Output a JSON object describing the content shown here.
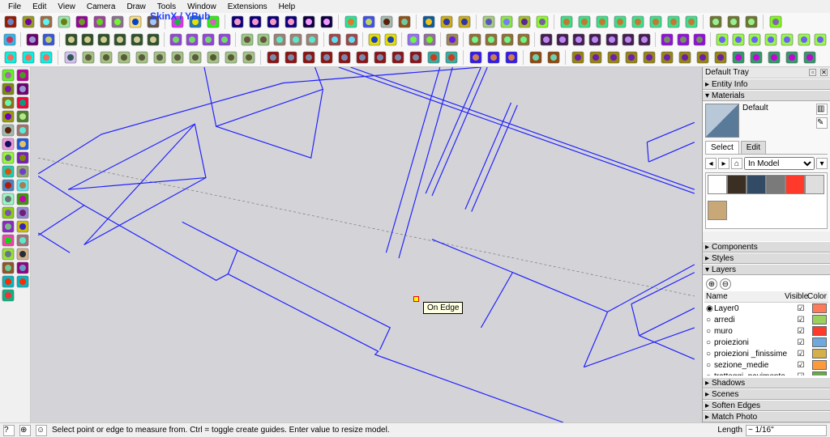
{
  "menubar": [
    "File",
    "Edit",
    "View",
    "Camera",
    "Draw",
    "Tools",
    "Window",
    "Extensions",
    "Help"
  ],
  "plugin_title": "SkinX / YBub",
  "tooltip": "On Edge",
  "tray": {
    "title": "Default Tray",
    "sections": {
      "entity_info": "Entity Info",
      "materials": "Materials",
      "components": "Components",
      "styles": "Styles",
      "layers": "Layers",
      "shadows": "Shadows",
      "scenes": "Scenes",
      "soften": "Soften Edges",
      "match_photo": "Match Photo"
    }
  },
  "materials": {
    "name": "Default",
    "tabs": {
      "select": "Select",
      "edit": "Edit"
    },
    "dropdown": "In Model",
    "swatches": [
      "#ffffff",
      "#3b2e23",
      "#334a65",
      "#7a7a7a",
      "#ff3a2a",
      "#dedede",
      "#c9a877"
    ]
  },
  "layers": {
    "controls": {
      "add": "⊕",
      "remove": "⊖"
    },
    "headers": {
      "name": "Name",
      "visible": "Visible",
      "color": "Color"
    },
    "items": [
      {
        "name": "Layer0",
        "visible": true,
        "current": true,
        "color": "#ff7a5a"
      },
      {
        "name": "arredi",
        "visible": true,
        "current": false,
        "color": "#9ad05b"
      },
      {
        "name": "muro",
        "visible": true,
        "current": false,
        "color": "#ff3a2a"
      },
      {
        "name": "proiezioni",
        "visible": true,
        "current": false,
        "color": "#6fa8dc"
      },
      {
        "name": "proiezioni _finissime",
        "visible": true,
        "current": false,
        "color": "#d4b04a"
      },
      {
        "name": "sezione_medie",
        "visible": true,
        "current": false,
        "color": "#ff9a3a"
      },
      {
        "name": "tratteggi_pavimento",
        "visible": true,
        "current": false,
        "color": "#6aa84f"
      }
    ]
  },
  "status": {
    "hint": "Select point or edge to measure from. Ctrl = toggle create guides. Enter value to resize model.",
    "length_label": "Length",
    "length_value": "~ 1/16\""
  },
  "icons": {
    "row1": [
      "undo",
      "redo",
      "new",
      "open",
      "save",
      "cut",
      "copy",
      "paste",
      "erase",
      "sep",
      "red-sq",
      "orange-sq",
      "question",
      "sep",
      "cube1",
      "cube2",
      "cube3",
      "cube4",
      "cube5",
      "cube6",
      "sep",
      "slash",
      "pencil",
      "arc",
      "wave",
      "sep",
      "cross",
      "cross2",
      "cross3",
      "sep",
      "up",
      "down",
      "box",
      "box2",
      "sep",
      "book1",
      "book2",
      "book3",
      "book4",
      "book5",
      "book6",
      "book7",
      "book8",
      "sep",
      "stamp1",
      "stamp2",
      "stamp3",
      "sep",
      "globe"
    ],
    "row2": [
      "arrow",
      "sep",
      "eraser",
      "brush",
      "sep",
      "cube-a",
      "cube-b",
      "cube-c",
      "cube-d",
      "cube-e",
      "cube-f",
      "sep",
      "rot1",
      "rot2",
      "rot3",
      "rot4",
      "sep",
      "sun1",
      "sun2",
      "sq1",
      "sq2",
      "sq3",
      "sep",
      "dl1",
      "dl2",
      "sep",
      "coffee1",
      "coffee2",
      "sep",
      "push",
      "pull",
      "sep",
      "xray",
      "sep",
      "win1",
      "win2",
      "win3",
      "win4",
      "sep",
      "grid1",
      "grid2",
      "grid3",
      "grid4",
      "grid5",
      "grid6",
      "grid7",
      "sep",
      "sec1",
      "sec2",
      "sec3",
      "sep",
      "out1",
      "out2",
      "out3",
      "out4",
      "out5",
      "out6",
      "out7"
    ],
    "row3": [
      "comp1",
      "comp2",
      "comp3",
      "sep",
      "red-dot",
      "a",
      "b",
      "c",
      "d",
      "e",
      "f",
      "g",
      "h",
      "i",
      "j",
      "sep",
      "arr1",
      "arr2",
      "arr3",
      "arr4",
      "arr5",
      "arr6",
      "arr7",
      "arr8",
      "arr9",
      "arr10",
      "arr11",
      "sep",
      "blue1",
      "blue2",
      "blue3",
      "sep",
      "grp1",
      "grp2",
      "sep",
      "tex1",
      "tex2",
      "tex3",
      "tex4",
      "tex5",
      "tex6",
      "tex7",
      "tex8",
      "tex9",
      "tex10",
      "tex11",
      "tex12",
      "tex13",
      "tex14"
    ],
    "left": [
      "select",
      "lasso",
      "bucket",
      "eraser",
      "line",
      "freehand",
      "rect",
      "circle",
      "arc",
      "pie",
      "polygon",
      "3dtext",
      "move",
      "rotate",
      "scale",
      "offset",
      "pushpull",
      "followme",
      "tape",
      "protractor",
      "dims",
      "text",
      "axes",
      "section",
      "orbit",
      "pan",
      "zoom",
      "zoomext",
      "walk",
      "look",
      "plugin1",
      "plugin2",
      "plugin3"
    ]
  }
}
